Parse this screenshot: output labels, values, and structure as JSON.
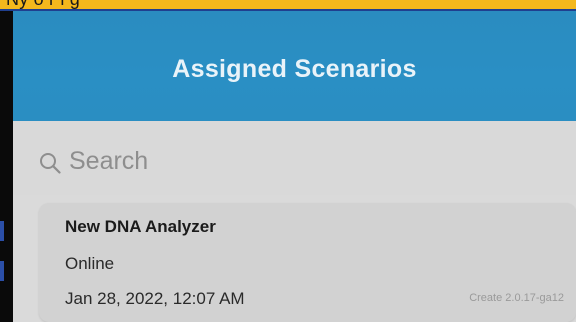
{
  "banner": {
    "text": "Ny                          o      r             l        g"
  },
  "header": {
    "title": "Assigned Scenarios"
  },
  "search": {
    "placeholder": "Search",
    "icon": "search-icon"
  },
  "scenarios": [
    {
      "name": "New DNA Analyzer",
      "status": "Online",
      "datetime": "Jan 28, 2022, 12:07 AM",
      "version": "Create 2.0.17-ga12"
    }
  ],
  "colors": {
    "header_bg": "#2a8ec2",
    "header_text": "#e9f3f9",
    "screen_bg": "#dadada",
    "card_bg": "#d2d2d2",
    "banner_bg": "#f4b81c"
  }
}
